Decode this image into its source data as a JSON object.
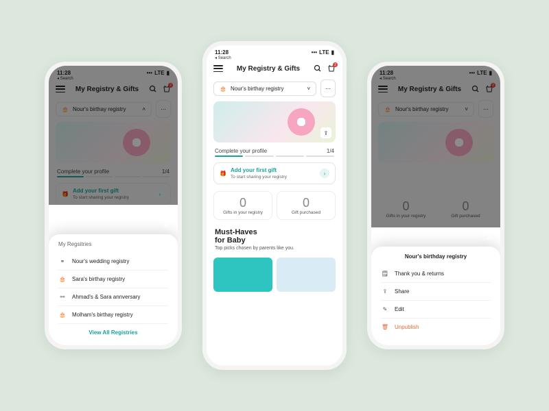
{
  "status": {
    "time": "11:28",
    "back": "Search",
    "network": "LTE"
  },
  "header": {
    "title": "My Registry & Gifts",
    "cart_badge": "2"
  },
  "registry": {
    "current": "Nour's birthay registry"
  },
  "profile": {
    "label": "Complete your profile",
    "step": "1/4"
  },
  "tip": {
    "title": "Add your first gift",
    "sub": "To start sharing your registry"
  },
  "stats": {
    "a_num": "0",
    "a_lbl": "Gifts in your registry",
    "b_num": "0",
    "b_lbl": "Gift purchased"
  },
  "must": {
    "title1": "Must-Haves",
    "title2": "for Baby",
    "sub": "Top picks chosen by parents like you."
  },
  "sheet_registries": {
    "title": "My Regsitries",
    "items": [
      "Nour's wedding registry",
      "Sara's birthay registry",
      "Ahmad's & Sara annversary",
      "Molham's birthay registry"
    ],
    "view_all": "View All Registries"
  },
  "sheet_actions": {
    "title": "Nour's birthday registry",
    "thank": "Thank you & returns",
    "share": "Share",
    "edit": "Edit",
    "unpublish": "Unpublish"
  }
}
